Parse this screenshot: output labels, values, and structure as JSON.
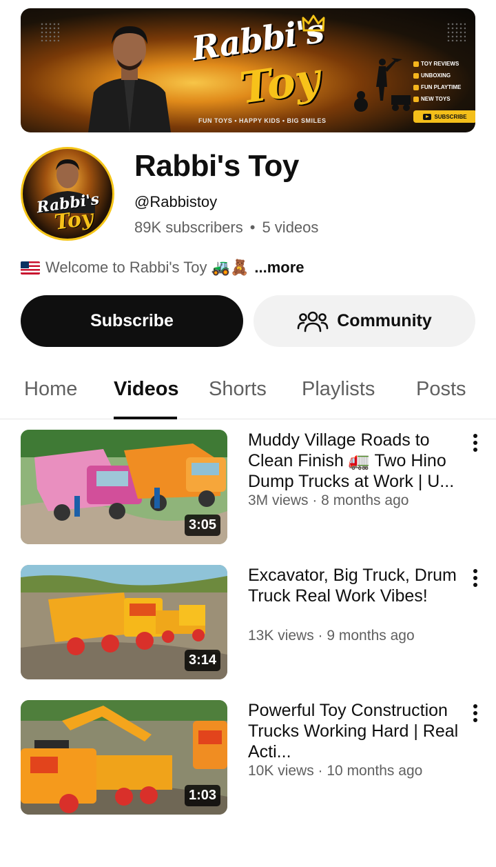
{
  "banner": {
    "title_line1": "Rabbi's",
    "title_line2": "Toy",
    "tagline": "FUN TOYS • HAPPY KIDS • BIG SMILES",
    "features": [
      "TOY REVIEWS",
      "UNBOXING",
      "FUN PLAYTIME",
      "NEW TOYS"
    ],
    "subscribe_label": "SUBSCRIBE"
  },
  "avatar": {
    "line1": "Rabbi's",
    "line2": "Toy"
  },
  "channel": {
    "name": "Rabbi's Toy",
    "handle": "@Rabbistoy",
    "subscribers": "89K subscribers",
    "separator": "•",
    "videos": "5 videos",
    "description": "Welcome to Rabbi's Toy 🚜🧸",
    "more_label": "...more"
  },
  "actions": {
    "subscribe_label": "Subscribe",
    "community_label": "Community"
  },
  "tabs": [
    {
      "label": "Home"
    },
    {
      "label": "Videos"
    },
    {
      "label": "Shorts"
    },
    {
      "label": "Playlists"
    },
    {
      "label": "Posts"
    }
  ],
  "active_tab": "Videos",
  "videos": [
    {
      "title": "Muddy Village Roads to Clean Finish 🚛 Two Hino Dump Trucks at Work | U...",
      "meta": "3M views · 8 months ago",
      "duration": "3:05"
    },
    {
      "title": "Excavator, Big Truck, Drum Truck Real Work Vibes!",
      "meta": "13K views · 9 months ago",
      "duration": "3:14"
    },
    {
      "title": "Powerful Toy Construction Trucks Working Hard | Real Acti...",
      "meta": "10K views · 10 months ago",
      "duration": "1:03"
    }
  ],
  "colors": {
    "accent_yellow": "#f5c518",
    "text_primary": "#0f0f0f",
    "text_secondary": "#606060",
    "button_dark": "#0f0f0f",
    "button_light": "#f2f2f2"
  }
}
